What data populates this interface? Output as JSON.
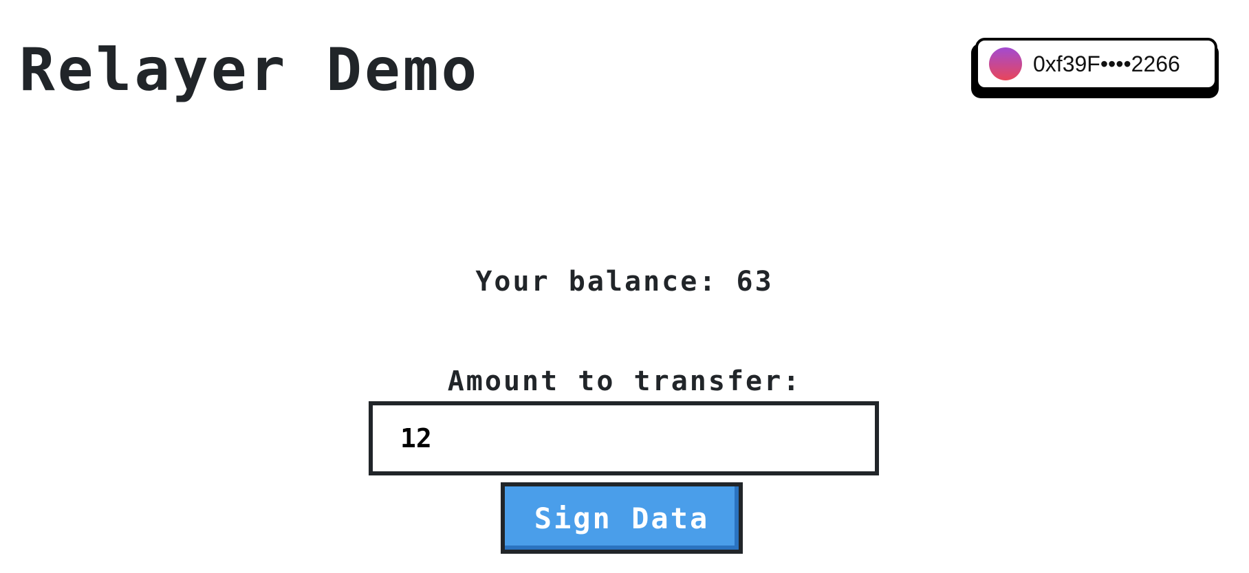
{
  "header": {
    "title": "Relayer Demo"
  },
  "wallet": {
    "address": "0xf39F••••2266",
    "avatar_icon": "gradient-avatar-icon",
    "avatar_colors": [
      "#a24bd1",
      "#e8465a"
    ]
  },
  "main": {
    "balance_text": "Your balance: 63",
    "amount_label": "Amount to transfer:",
    "amount_value": "12",
    "sign_button_label": "Sign Data"
  },
  "colors": {
    "text": "#212529",
    "button": "#4a9eea",
    "button_shadow": "#2b73c0",
    "background": "#ffffff"
  }
}
